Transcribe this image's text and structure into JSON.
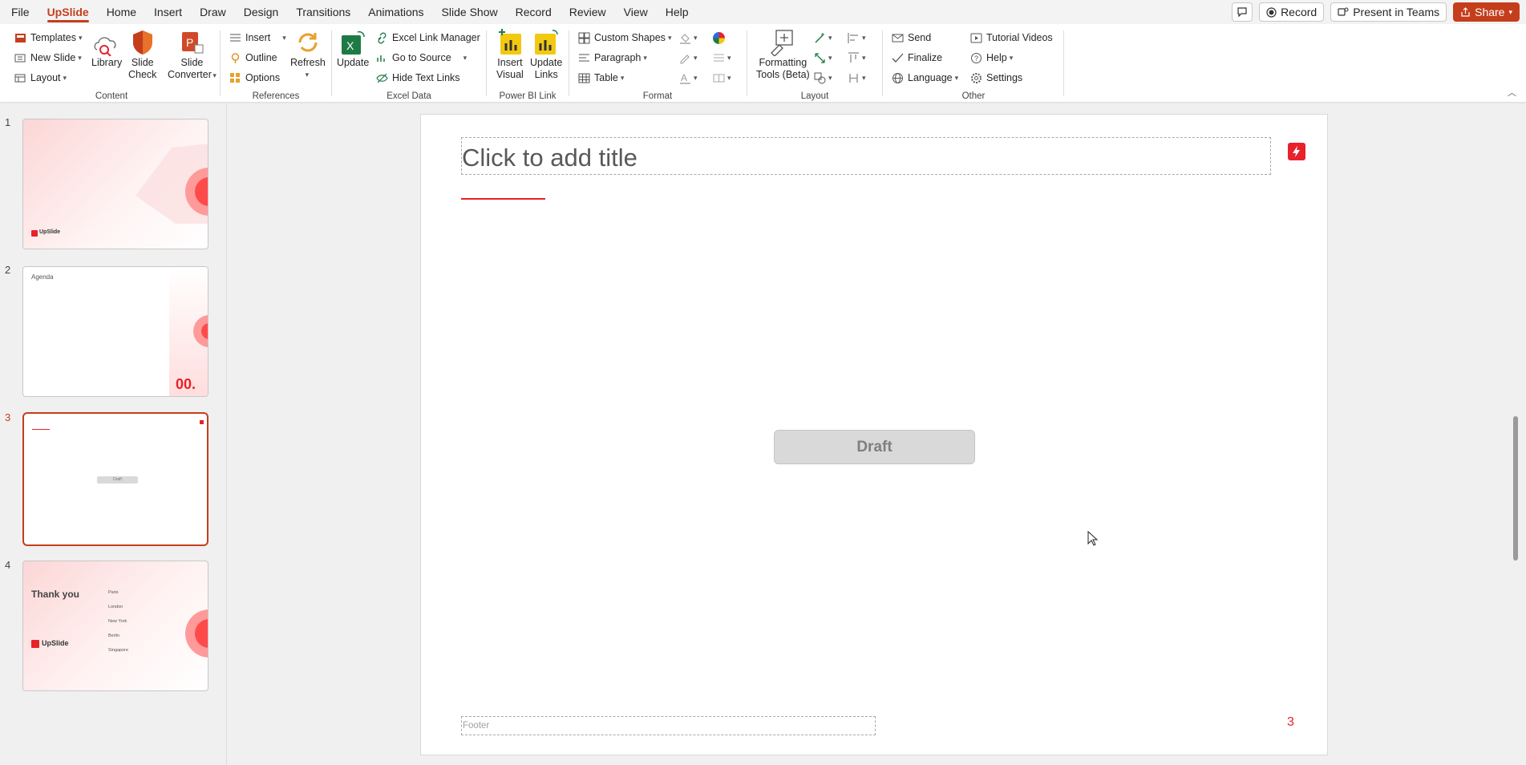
{
  "menu": {
    "tabs": [
      "File",
      "UpSlide",
      "Home",
      "Insert",
      "Draw",
      "Design",
      "Transitions",
      "Animations",
      "Slide Show",
      "Record",
      "Review",
      "View",
      "Help"
    ],
    "active_tab": "UpSlide",
    "record": "Record",
    "present": "Present in Teams",
    "share": "Share"
  },
  "ribbon": {
    "content": {
      "label": "Content",
      "templates": "Templates",
      "new_slide": "New Slide",
      "layout": "Layout",
      "library": "Library",
      "slide_check_1": "Slide",
      "slide_check_2": "Check",
      "slide_conv_1": "Slide",
      "slide_conv_2": "Converter"
    },
    "references": {
      "label": "References",
      "insert": "Insert",
      "outline": "Outline",
      "options": "Options",
      "refresh": "Refresh"
    },
    "excel": {
      "label": "Excel Data",
      "update": "Update",
      "link_manager": "Excel Link Manager",
      "go_to_source": "Go to Source",
      "hide_links": "Hide Text Links"
    },
    "powerbi": {
      "label": "Power BI Link",
      "insert_1": "Insert",
      "insert_2": "Visual",
      "update_1": "Update",
      "update_2": "Links"
    },
    "format": {
      "label": "Format",
      "custom_shapes": "Custom Shapes",
      "paragraph": "Paragraph",
      "table": "Table"
    },
    "layout": {
      "label": "Layout",
      "formatting_1": "Formatting",
      "formatting_2": "Tools (Beta)"
    },
    "other": {
      "label": "Other",
      "send": "Send",
      "finalize": "Finalize",
      "language": "Language",
      "tutorials": "Tutorial Videos",
      "help": "Help",
      "settings": "Settings"
    }
  },
  "thumbnails": [
    {
      "number": "1",
      "brand": "UpSlide"
    },
    {
      "number": "2",
      "title": "Agenda",
      "big": "00."
    },
    {
      "number": "3",
      "draft": "Draft"
    },
    {
      "number": "4",
      "title": "Thank you",
      "brand": "UpSlide",
      "offices": [
        "Paris",
        "London",
        "New York",
        "Berlin",
        "Singapore"
      ]
    }
  ],
  "active_slide": "3",
  "slide": {
    "title_placeholder": "Click to add title",
    "draft": "Draft",
    "footer_placeholder": "Footer",
    "page_number": "3"
  },
  "colors": {
    "accent": "#c43e1c",
    "upslide_red": "#e8212b"
  }
}
